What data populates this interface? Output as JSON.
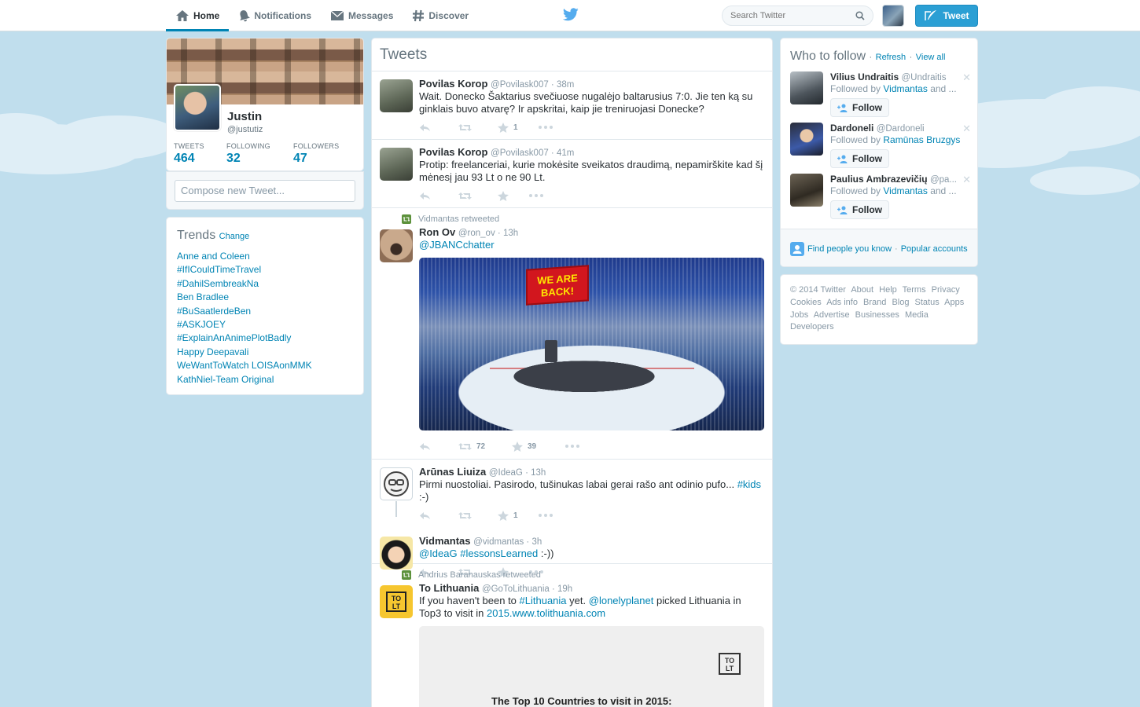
{
  "colors": {
    "accent": "#0084b4",
    "background": "#c0deed",
    "tweet_button": "#2b9fd4",
    "retweet_green": "#5c913b"
  },
  "nav": {
    "items": [
      {
        "label": "Home",
        "icon": "home-icon",
        "active": true
      },
      {
        "label": "Notifications",
        "icon": "bell-icon"
      },
      {
        "label": "Messages",
        "icon": "envelope-icon"
      },
      {
        "label": "Discover",
        "icon": "hashtag-icon"
      }
    ]
  },
  "search": {
    "placeholder": "Search Twitter"
  },
  "tweet_button": {
    "label": "Tweet"
  },
  "profile": {
    "name": "Justin",
    "handle": "@justutiz",
    "stats": [
      {
        "label": "TWEETS",
        "value": "464"
      },
      {
        "label": "FOLLOWING",
        "value": "32"
      },
      {
        "label": "FOLLOWERS",
        "value": "47"
      }
    ],
    "compose_placeholder": "Compose new Tweet..."
  },
  "trends": {
    "title": "Trends",
    "change_label": "Change",
    "items": [
      "Anne and Coleen",
      "#IfICouldTimeTravel",
      "#DahilSembreakNa",
      "Ben Bradlee",
      "#BuSaatlerdeBen",
      "#ASKJOEY",
      "#ExplainAnAnimePlotBadly",
      "Happy Deepavali",
      "WeWantToWatch LOISAonMMK",
      "KathNiel-Team Original"
    ]
  },
  "stream": {
    "title": "Tweets",
    "tweets": [
      {
        "name": "Povilas Korop",
        "handle": "@Povilask007",
        "time": "38m",
        "text": "Wait. Donecko Šaktarius svečiuose nugalėjo baltarusius 7:0. Jie ten ką su ginklais buvo atvarę? Ir apskritai, kaip jie treniruojasi Donecke?",
        "favorites": "1"
      },
      {
        "name": "Povilas Korop",
        "handle": "@Povilask007",
        "time": "41m",
        "text": "Protip: freelanceriai, kurie mokėsite sveikatos draudimą, nepamirškite kad šį mėnesį jau 93 Lt o ne 90 Lt."
      },
      {
        "retweeted_by": "Vidmantas retweeted",
        "name": "Ron Ov",
        "handle": "@ron_ov",
        "time": "13h",
        "text": "@JBANCchatter",
        "image_sign": "WE ARE BACK!",
        "retweets": "72",
        "favorites": "39"
      },
      {
        "name": "Arūnas Liuiza",
        "handle": "@IdeaG",
        "time": "13h",
        "text": "Pirmi nuostoliai. Pasirodo, tušinukas labai gerai rašo ant odinio pufo...",
        "hashtag": "#kids",
        "suffix": ":-)",
        "favorites": "1"
      },
      {
        "name": "Vidmantas",
        "handle": "@vidmantas",
        "time": "3h",
        "mention": "@IdeaG",
        "hashtag": "#lessonsLearned",
        "suffix": ":-))"
      },
      {
        "retweeted_by": "Andrius Baranauskas retweeted",
        "name": "To Lithuania",
        "handle": "@GoToLithuania",
        "time": "19h",
        "text_1": "If you haven't been to",
        "hashtag": "#Lithuania",
        "text_2": "yet.",
        "mention": "@lonelyplanet",
        "text_3": "picked Lithuania in Top3 to visit in",
        "url": "2015.www.tolithuania.com",
        "logo_text": "TO LT",
        "card_title": "The Top 10 Countries to visit in 2015:"
      }
    ]
  },
  "who_to_follow": {
    "title": "Who to follow",
    "refresh": "Refresh",
    "view_all": "View all",
    "follow_label": "Follow",
    "suggestions": [
      {
        "name": "Vilius Undraitis",
        "handle": "@Undraitis",
        "followed_prefix": "Followed by",
        "followed_by": "Vidmantas",
        "followed_suffix": "and ..."
      },
      {
        "name": "Dardoneli",
        "handle": "@Dardoneli",
        "followed_prefix": "Followed by",
        "followed_by": "Ramūnas Bruzgys",
        "followed_suffix": ""
      },
      {
        "name": "Paulius Ambrazevičių",
        "handle": "@pa...",
        "followed_prefix": "Followed by",
        "followed_by": "Vidmantas",
        "followed_suffix": "and ..."
      }
    ],
    "find_people": "Find people you know",
    "popular": "Popular accounts"
  },
  "footer": {
    "links": [
      "© 2014 Twitter",
      "About",
      "Help",
      "Terms",
      "Privacy",
      "Cookies",
      "Ads info",
      "Brand",
      "Blog",
      "Status",
      "Apps",
      "Jobs",
      "Advertise",
      "Businesses",
      "Media",
      "Developers"
    ]
  }
}
